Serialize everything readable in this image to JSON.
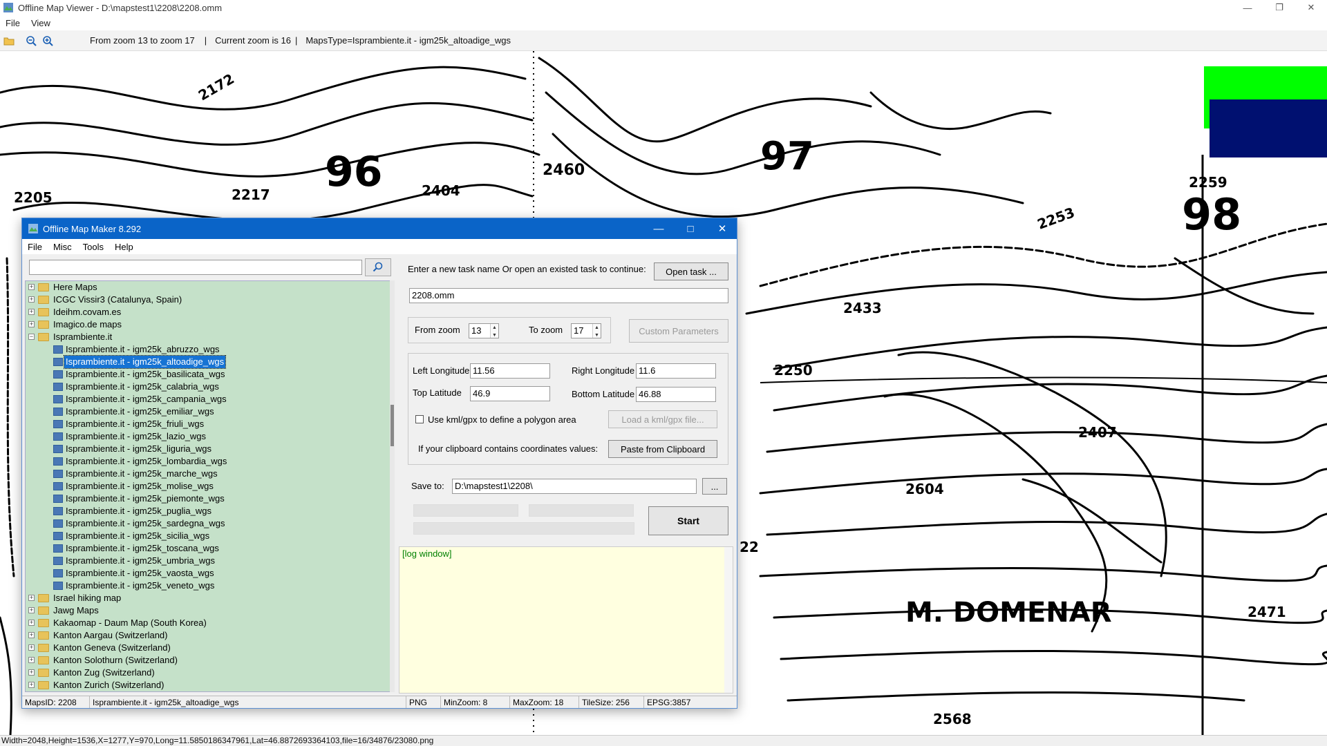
{
  "viewer": {
    "title": "Offline Map Viewer - D:\\mapstest1\\2208\\2208.omm",
    "menu": [
      "File",
      "View"
    ],
    "toolbar_info": {
      "zoom_range": "From zoom 13 to zoom 17",
      "current_zoom": "Current zoom is 16",
      "maps_type": "MapsType=Isprambiente.it - igm25k_altoadige_wgs"
    },
    "status": "Width=2048,Height=1536,X=1277,Y=970,Long=11.5850186347961,Lat=46.8872693364103,file=16/34876/23080.png"
  },
  "map": {
    "labels": [
      "2172",
      "96",
      "2205",
      "2217",
      "2404",
      "2460",
      "97",
      "2259",
      "98",
      "2253",
      "2433",
      "2250",
      "2407",
      "2604",
      "22",
      "M. DOMENAR",
      "2471",
      "2568"
    ],
    "accent_green": "#00ff00",
    "accent_blue": "#001070"
  },
  "dialog": {
    "title": "Offline Map Maker 8.292",
    "menu": [
      "File",
      "Misc",
      "Tools",
      "Help"
    ],
    "search_value": "",
    "tree": [
      {
        "label": "Here Maps",
        "type": "folder",
        "level": 0,
        "expanded": false
      },
      {
        "label": "ICGC Vissir3 (Catalunya, Spain)",
        "type": "folder",
        "level": 0,
        "expanded": false
      },
      {
        "label": "Ideihm.covam.es",
        "type": "folder",
        "level": 0,
        "expanded": false
      },
      {
        "label": "Imagico.de maps",
        "type": "folder",
        "level": 0,
        "expanded": false
      },
      {
        "label": "Isprambiente.it",
        "type": "folder",
        "level": 0,
        "expanded": true
      },
      {
        "label": "Isprambiente.it - igm25k_abruzzo_wgs",
        "type": "map",
        "level": 1
      },
      {
        "label": "Isprambiente.it - igm25k_altoadige_wgs",
        "type": "map",
        "level": 1,
        "selected": true
      },
      {
        "label": "Isprambiente.it - igm25k_basilicata_wgs",
        "type": "map",
        "level": 1
      },
      {
        "label": "Isprambiente.it - igm25k_calabria_wgs",
        "type": "map",
        "level": 1
      },
      {
        "label": "Isprambiente.it - igm25k_campania_wgs",
        "type": "map",
        "level": 1
      },
      {
        "label": "Isprambiente.it - igm25k_emiliar_wgs",
        "type": "map",
        "level": 1
      },
      {
        "label": "Isprambiente.it - igm25k_friuli_wgs",
        "type": "map",
        "level": 1
      },
      {
        "label": "Isprambiente.it - igm25k_lazio_wgs",
        "type": "map",
        "level": 1
      },
      {
        "label": "Isprambiente.it - igm25k_liguria_wgs",
        "type": "map",
        "level": 1
      },
      {
        "label": "Isprambiente.it - igm25k_lombardia_wgs",
        "type": "map",
        "level": 1
      },
      {
        "label": "Isprambiente.it - igm25k_marche_wgs",
        "type": "map",
        "level": 1
      },
      {
        "label": "Isprambiente.it - igm25k_molise_wgs",
        "type": "map",
        "level": 1
      },
      {
        "label": "Isprambiente.it - igm25k_piemonte_wgs",
        "type": "map",
        "level": 1
      },
      {
        "label": "Isprambiente.it - igm25k_puglia_wgs",
        "type": "map",
        "level": 1
      },
      {
        "label": "Isprambiente.it - igm25k_sardegna_wgs",
        "type": "map",
        "level": 1
      },
      {
        "label": "Isprambiente.it - igm25k_sicilia_wgs",
        "type": "map",
        "level": 1
      },
      {
        "label": "Isprambiente.it - igm25k_toscana_wgs",
        "type": "map",
        "level": 1
      },
      {
        "label": "Isprambiente.it - igm25k_umbria_wgs",
        "type": "map",
        "level": 1
      },
      {
        "label": "Isprambiente.it - igm25k_vaosta_wgs",
        "type": "map",
        "level": 1
      },
      {
        "label": "Isprambiente.it - igm25k_veneto_wgs",
        "type": "map",
        "level": 1
      },
      {
        "label": "Israel hiking map",
        "type": "folder",
        "level": 0,
        "expanded": false
      },
      {
        "label": "Jawg Maps",
        "type": "folder",
        "level": 0,
        "expanded": false
      },
      {
        "label": "Kakaomap - Daum Map (South Korea)",
        "type": "folder",
        "level": 0,
        "expanded": false
      },
      {
        "label": "Kanton Aargau (Switzerland)",
        "type": "folder",
        "level": 0,
        "expanded": false
      },
      {
        "label": "Kanton Geneva (Switzerland)",
        "type": "folder",
        "level": 0,
        "expanded": false
      },
      {
        "label": "Kanton Solothurn (Switzerland)",
        "type": "folder",
        "level": 0,
        "expanded": false
      },
      {
        "label": "Kanton Zug (Switzerland)",
        "type": "folder",
        "level": 0,
        "expanded": false
      },
      {
        "label": "Kanton Zurich (Switzerland)",
        "type": "folder",
        "level": 0,
        "expanded": false
      }
    ],
    "task": {
      "prompt": "Enter a new task name Or open an existed task to continue:",
      "open_task_label": "Open task ...",
      "task_name": "2208.omm"
    },
    "zoom": {
      "from_label": "From zoom",
      "from_value": "13",
      "to_label": "To zoom",
      "to_value": "17",
      "custom_label": "Custom Parameters"
    },
    "coords": {
      "left_lon_label": "Left Longitude",
      "left_lon": "11.56",
      "right_lon_label": "Right Longitude",
      "right_lon": "11.6",
      "top_lat_label": "Top Latitude",
      "top_lat": "46.9",
      "bottom_lat_label": "Bottom Latitude",
      "bottom_lat": "46.88",
      "kml_label": "Use kml/gpx to define a polygon area",
      "kml_button": "Load a kml/gpx file...",
      "clipboard_text": "If your clipboard contains coordinates values:",
      "clipboard_button": "Paste from Clipboard"
    },
    "save": {
      "label": "Save to:",
      "path": "D:\\mapstest1\\2208\\",
      "browse": "..."
    },
    "start_label": "Start",
    "log_text": "[log window]",
    "status": {
      "maps_id": "MapsID: 2208",
      "name": "Isprambiente.it - igm25k_altoadige_wgs",
      "format": "PNG",
      "min_zoom": "MinZoom: 8",
      "max_zoom": "MaxZoom: 18",
      "tile_size": "TileSize: 256",
      "epsg": "EPSG:3857"
    }
  }
}
